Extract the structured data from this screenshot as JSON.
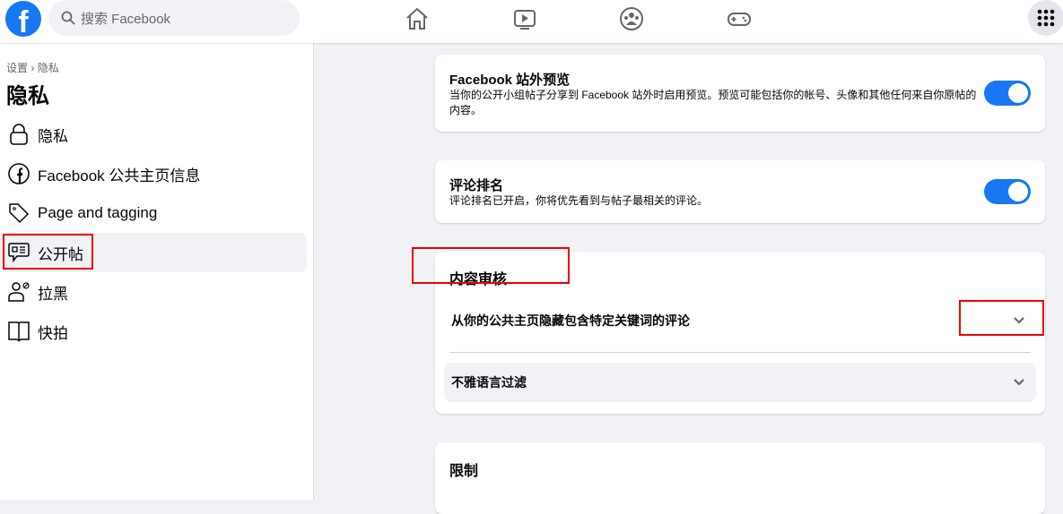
{
  "search": {
    "placeholder": "搜索 Facebook"
  },
  "breadcrumb": {
    "parent": "设置",
    "sep": "›",
    "current": "隐私"
  },
  "page_title": "隐私",
  "sidebar": {
    "items": [
      {
        "label": "隐私"
      },
      {
        "label": "Facebook 公共主页信息"
      },
      {
        "label": "Page and tagging"
      },
      {
        "label": "公开帖"
      },
      {
        "label": "拉黑"
      },
      {
        "label": "快拍"
      }
    ]
  },
  "cards": {
    "offsite": {
      "title": "Facebook 站外预览",
      "desc": "当你的公开小组帖子分享到 Facebook 站外时启用预览。预览可能包括你的帐号、头像和其他任何来自你原帖的内容。",
      "enabled": true
    },
    "ranking": {
      "title": "评论排名",
      "desc": "评论排名已开启，你将优先看到与帖子最相关的评论。",
      "enabled": true
    },
    "moderation": {
      "title": "内容审核",
      "rows": [
        {
          "label": "从你的公共主页隐藏包含特定关键词的评论"
        },
        {
          "label": "不雅语言过滤"
        }
      ]
    },
    "limits": {
      "title": "限制"
    }
  },
  "colors": {
    "accent": "#1877f2",
    "highlight": "#e00000"
  }
}
